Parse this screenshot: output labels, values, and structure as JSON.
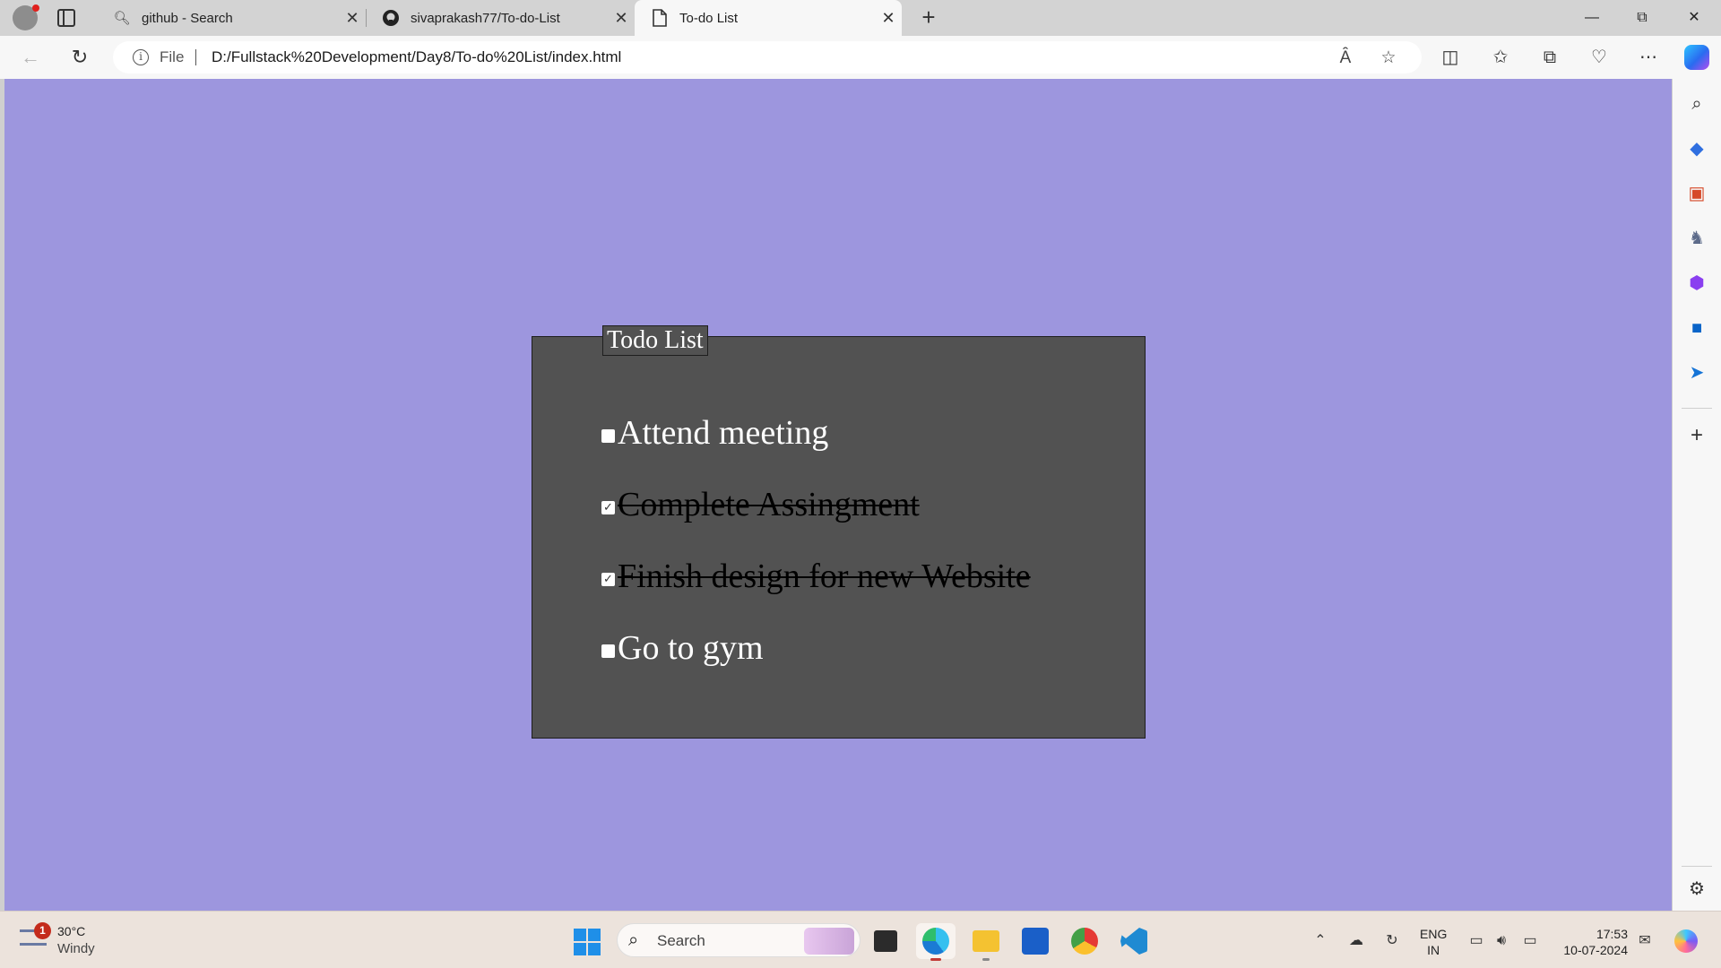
{
  "browser": {
    "tabs": [
      {
        "title": "github - Search",
        "favicon": "search-icon",
        "active": false
      },
      {
        "title": "sivaprakash77/To-do-List",
        "favicon": "github-icon",
        "active": false
      },
      {
        "title": "To-do List",
        "favicon": "document-icon",
        "active": true
      }
    ],
    "address": {
      "scheme_label": "File",
      "url": "D:/Fullstack%20Development/Day8/To-do%20List/index.html"
    }
  },
  "page": {
    "background_color": "#9d96de",
    "panel_color": "#525252",
    "legend": "Todo List",
    "items": [
      {
        "text": "Attend meeting",
        "checked": false
      },
      {
        "text": "Complete Assingment",
        "checked": true
      },
      {
        "text": "Finish design for new Website",
        "checked": true
      },
      {
        "text": "Go to gym",
        "checked": false
      }
    ]
  },
  "taskbar": {
    "weather": {
      "badge": "1",
      "temp": "30°C",
      "condition": "Windy"
    },
    "search_label": "Search",
    "lang": {
      "line1": "ENG",
      "line2": "IN"
    },
    "clock": {
      "time": "17:53",
      "date": "10-07-2024"
    }
  }
}
